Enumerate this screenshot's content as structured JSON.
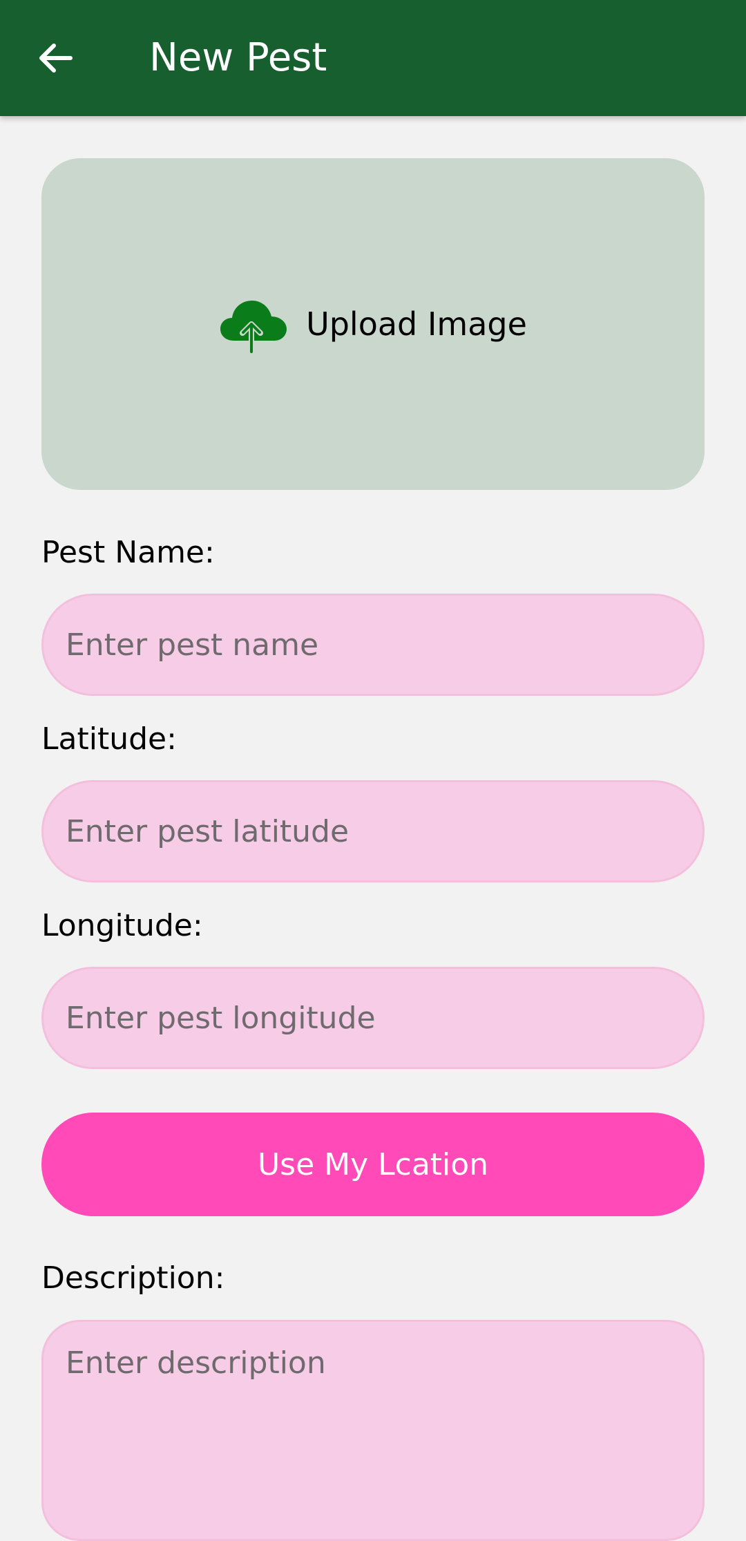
{
  "app_bar": {
    "title": "New Pest",
    "back_icon": "arrow-left-icon",
    "background_color": "#185f30"
  },
  "upload": {
    "label": "Upload Image",
    "icon": "cloud-upload-icon",
    "icon_color": "#0a7d1a",
    "background_color": "#c9d7cd"
  },
  "form": {
    "pest_name": {
      "label": "Pest Name:",
      "placeholder": "Enter pest name",
      "value": ""
    },
    "latitude": {
      "label": "Latitude:",
      "placeholder": "Enter pest latitude",
      "value": ""
    },
    "longitude": {
      "label": "Longitude:",
      "placeholder": "Enter pest longitude",
      "value": ""
    },
    "location_button": {
      "label": "Use My Lcation",
      "color": "#ff4ab8"
    },
    "description": {
      "label": "Description:",
      "placeholder": "Enter description",
      "value": ""
    }
  }
}
